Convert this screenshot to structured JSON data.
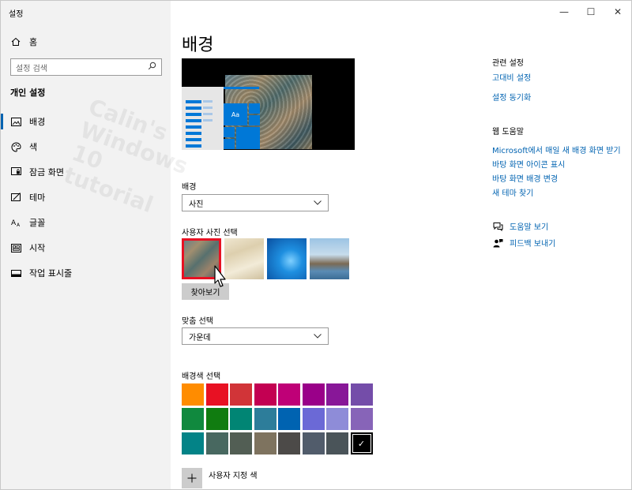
{
  "window": {
    "title": "설정",
    "minimize": "—",
    "maximize": "☐",
    "close": "✕"
  },
  "sidebar": {
    "home": "홈",
    "search_placeholder": "설정 검색",
    "section_title": "개인 설정",
    "items": [
      {
        "label": "배경",
        "icon": "picture-icon"
      },
      {
        "label": "색",
        "icon": "palette-icon"
      },
      {
        "label": "잠금 화면",
        "icon": "lock-screen-icon"
      },
      {
        "label": "테마",
        "icon": "theme-icon"
      },
      {
        "label": "글꼴",
        "icon": "font-icon"
      },
      {
        "label": "시작",
        "icon": "start-icon"
      },
      {
        "label": "작업 표시줄",
        "icon": "taskbar-icon"
      }
    ],
    "watermark": [
      "Calin's",
      "Windows 10",
      "tutorial"
    ]
  },
  "main": {
    "title": "배경",
    "preview_tile_text": "Aa",
    "background_label": "배경",
    "background_value": "사진",
    "choose_picture_label": "사용자 사진 선택",
    "browse_button": "찾아보기",
    "fit_label": "맞춤 선택",
    "fit_value": "가운데",
    "color_label": "배경색 선택",
    "custom_color_label": "사용자 지정 색",
    "colors": [
      [
        "#ff8c00",
        "#e81123",
        "#d13438",
        "#c30052",
        "#bf0077",
        "#9a0089",
        "#881798",
        "#744da9"
      ],
      [
        "#10893e",
        "#107c10",
        "#018574",
        "#2d7d9a",
        "#0063b1",
        "#6b69d6",
        "#8e8cd8",
        "#8764b8"
      ],
      [
        "#038387",
        "#486860",
        "#525e54",
        "#7e735f",
        "#4c4a48",
        "#515c6b",
        "#4a5459",
        "#000000"
      ]
    ],
    "selected_color": "#000000",
    "check_glyph": "✓"
  },
  "related": {
    "heading": "관련 설정",
    "links": [
      "고대비 설정",
      "설정 동기화"
    ]
  },
  "web_help": {
    "heading": "웹 도움말",
    "links": [
      "Microsoft에서 매일 새 배경 화면 받기",
      "바탕 화면 아이콘 표시",
      "바탕 화면 배경 변경",
      "새 테마 찾기"
    ]
  },
  "help": {
    "get_help": "도움말 보기",
    "feedback": "피드백 보내기"
  }
}
